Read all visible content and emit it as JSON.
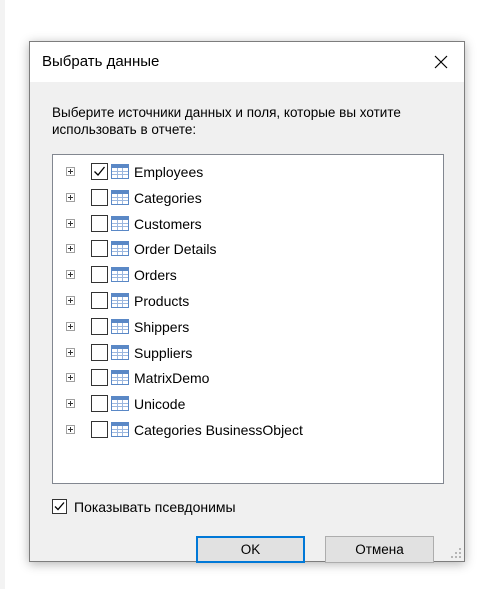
{
  "dialog": {
    "title": "Выбрать данные",
    "prompt": "Выберите источники данных и поля, которые вы хотите использовать в отчете:",
    "close_icon": "close-icon"
  },
  "tree": {
    "items": [
      {
        "label": "Employees",
        "checked": true
      },
      {
        "label": "Categories",
        "checked": false
      },
      {
        "label": "Customers",
        "checked": false
      },
      {
        "label": "Order Details",
        "checked": false
      },
      {
        "label": "Orders",
        "checked": false
      },
      {
        "label": "Products",
        "checked": false
      },
      {
        "label": "Shippers",
        "checked": false
      },
      {
        "label": "Suppliers",
        "checked": false
      },
      {
        "label": "MatrixDemo",
        "checked": false
      },
      {
        "label": "Unicode",
        "checked": false
      },
      {
        "label": "Categories BusinessObject",
        "checked": false
      }
    ],
    "item_icon": "table-icon",
    "expander_icon": "expand-plus-icon"
  },
  "options": {
    "show_aliases_label": "Показывать псевдонимы",
    "show_aliases_checked": true
  },
  "buttons": {
    "ok_label": "OK",
    "cancel_label": "Отмена"
  },
  "colors": {
    "accent": "#0078d7",
    "dialog_bg": "#f0f0f0",
    "table_icon": "#5a88c6"
  }
}
